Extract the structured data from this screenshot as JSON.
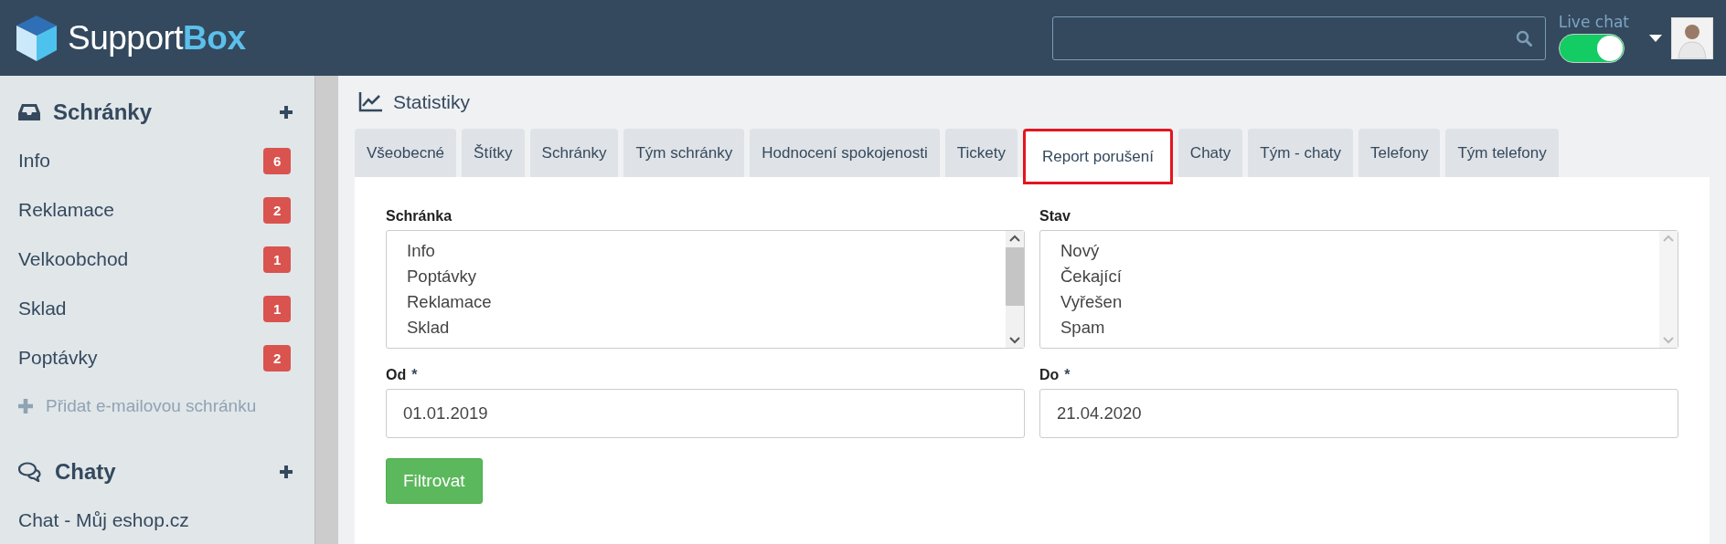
{
  "header": {
    "logo": {
      "text": "Support",
      "accent": "Box"
    },
    "live_chat": {
      "label": "Live chat",
      "on": true
    }
  },
  "sidebar": {
    "sections": [
      {
        "title": "Schránky",
        "items": [
          {
            "label": "Info",
            "count": "6"
          },
          {
            "label": "Reklamace",
            "count": "2"
          },
          {
            "label": "Velkoobchod",
            "count": "1"
          },
          {
            "label": "Sklad",
            "count": "1"
          },
          {
            "label": "Poptávky",
            "count": "2"
          }
        ],
        "add_link": "Přidat e-mailovou schránku"
      },
      {
        "title": "Chaty",
        "items": [
          {
            "label": "Chat - Můj eshop.cz"
          }
        ]
      }
    ]
  },
  "page": {
    "title": "Statistiky",
    "tabs": [
      {
        "label": "Všeobecné",
        "selected": false
      },
      {
        "label": "Štítky",
        "selected": false
      },
      {
        "label": "Schránky",
        "selected": false
      },
      {
        "label": "Tým schránky",
        "selected": false
      },
      {
        "label": "Hodnocení spokojenosti",
        "selected": false
      },
      {
        "label": "Tickety",
        "selected": false
      },
      {
        "label": "Report porušení",
        "selected": true
      },
      {
        "label": "Chaty",
        "selected": false
      },
      {
        "label": "Tým - chaty",
        "selected": false
      },
      {
        "label": "Telefony",
        "selected": false
      },
      {
        "label": "Tým telefony",
        "selected": false
      }
    ],
    "form": {
      "lists": [
        {
          "label": "Schránka",
          "options": [
            "Info",
            "Poptávky",
            "Reklamace",
            "Sklad"
          ],
          "scrollable": true
        },
        {
          "label": "Stav",
          "options": [
            "Nový",
            "Čekající",
            "Vyřešen",
            "Spam"
          ],
          "scrollable": false
        }
      ],
      "dates": [
        {
          "label": "Od",
          "required": "*",
          "value": "01.01.2019"
        },
        {
          "label": "Do",
          "required": "*",
          "value": "21.04.2020"
        }
      ],
      "button": "Filtrovat"
    }
  }
}
